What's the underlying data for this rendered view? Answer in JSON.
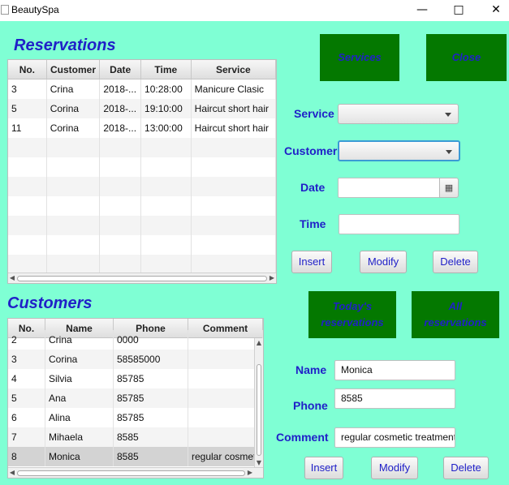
{
  "window": {
    "title": "BeautySpa",
    "minimize_icon": "minimize-icon",
    "maximize_icon": "maximize-icon",
    "close_icon": "close-icon"
  },
  "reservations": {
    "heading": "Reservations",
    "columns": [
      "No.",
      "Customer",
      "Date",
      "Time",
      "Service"
    ],
    "rows": [
      [
        "3",
        "Crina",
        "2018-...",
        "10:28:00",
        "Manicure Clasic"
      ],
      [
        "5",
        "Corina",
        "2018-...",
        "19:10:00",
        "Haircut short hair"
      ],
      [
        "11",
        "Corina",
        "2018-...",
        "13:00:00",
        "Haircut short hair"
      ]
    ]
  },
  "customers": {
    "heading": "Customers",
    "columns": [
      "No.",
      "Name",
      "Phone",
      "Comment"
    ],
    "rows": [
      [
        "2",
        "Crina",
        "0000",
        ""
      ],
      [
        "3",
        "Corina",
        "58585000",
        ""
      ],
      [
        "4",
        "Silvia",
        "85785",
        ""
      ],
      [
        "5",
        "Ana",
        "85785",
        ""
      ],
      [
        "6",
        "Alina",
        "85785",
        ""
      ],
      [
        "7",
        "Mihaela",
        "8585",
        ""
      ],
      [
        "8",
        "Monica",
        "8585",
        "regular cosmetic treatment"
      ]
    ],
    "selected_row": 6
  },
  "top_buttons": {
    "services": "Services",
    "close": "Close"
  },
  "reservation_form": {
    "service_label": "Service",
    "customer_label": "Customer",
    "date_label": "Date",
    "time_label": "Time",
    "service_value": "",
    "customer_value": "",
    "date_value": "",
    "time_value": "",
    "calendar_icon": "calendar-icon",
    "insert": "Insert",
    "modify": "Modify",
    "delete": "Delete"
  },
  "view_buttons": {
    "today_line1": "Today's",
    "today_line2": "reservations",
    "all_line1": "All",
    "all_line2": "reservations"
  },
  "customer_form": {
    "name_label": "Name",
    "phone_label": "Phone",
    "comment_label": "Comment",
    "name_value": "Monica",
    "phone_value": "8585",
    "comment_value": "regular cosmetic treatment",
    "insert": "Insert",
    "modify": "Modify",
    "delete": "Delete"
  },
  "colors": {
    "background": "#7fffd4",
    "accent_green": "#047800",
    "label_blue": "#2020c8"
  }
}
